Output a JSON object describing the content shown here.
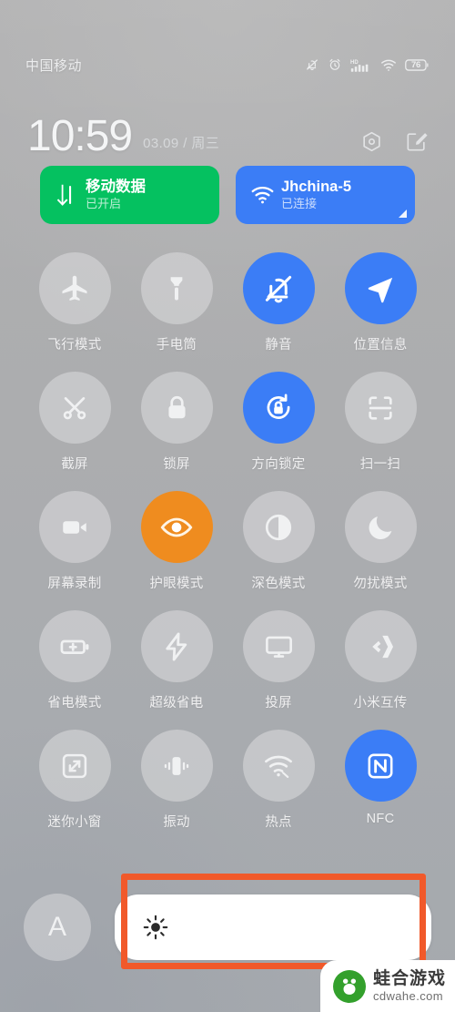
{
  "colors": {
    "accent_blue": "#3B7DF6",
    "accent_orange": "#EF8C1F",
    "accent_green": "#05C160",
    "annotation_red": "#F1592A",
    "background_gray": "#ABACAE",
    "tile_inactive": "rgba(220,221,223,.55)"
  },
  "status_bar": {
    "carrier": "中国移动",
    "battery_level": "76",
    "icons": [
      "bell-off-icon",
      "alarm-clock-icon",
      "hd-signal-icon",
      "wifi-icon",
      "battery-icon"
    ]
  },
  "header": {
    "time": "10:59",
    "date": "03.09 / 周三",
    "icons": [
      "settings-hex-icon",
      "edit-icon"
    ]
  },
  "connectivity_cards": [
    {
      "id": "mobile-data",
      "title": "移动数据",
      "subtitle": "已开启",
      "icon": "data-arrows-icon",
      "color": "#05C160",
      "has_corner_expand": false
    },
    {
      "id": "wifi",
      "title": "Jhchina-5",
      "subtitle": "已连接",
      "icon": "wifi-icon",
      "color": "#3B7DF6",
      "has_corner_expand": true
    }
  ],
  "toggles": [
    {
      "label": "飞行模式",
      "icon": "airplane-icon",
      "state": "off"
    },
    {
      "label": "手电筒",
      "icon": "flashlight-icon",
      "state": "off"
    },
    {
      "label": "静音",
      "icon": "bell-off-icon",
      "state": "on-blue"
    },
    {
      "label": "位置信息",
      "icon": "location-arrow-icon",
      "state": "on-blue"
    },
    {
      "label": "截屏",
      "icon": "screenshot-crop-icon",
      "state": "off"
    },
    {
      "label": "锁屏",
      "icon": "lock-icon",
      "state": "off"
    },
    {
      "label": "方向锁定",
      "icon": "rotation-lock-icon",
      "state": "on-blue"
    },
    {
      "label": "扫一扫",
      "icon": "scan-frame-icon",
      "state": "off"
    },
    {
      "label": "屏幕录制",
      "icon": "video-camera-icon",
      "state": "off"
    },
    {
      "label": "护眼模式",
      "icon": "eye-icon",
      "state": "on-orange"
    },
    {
      "label": "深色模式",
      "icon": "contrast-circle-icon",
      "state": "off"
    },
    {
      "label": "勿扰模式",
      "icon": "moon-icon",
      "state": "off"
    },
    {
      "label": "省电模式",
      "icon": "battery-plus-icon",
      "state": "off"
    },
    {
      "label": "超级省电",
      "icon": "lightning-bolt-icon",
      "state": "off"
    },
    {
      "label": "投屏",
      "icon": "cast-screen-icon",
      "state": "off"
    },
    {
      "label": "小米互传",
      "icon": "mi-share-icon",
      "state": "off"
    },
    {
      "label": "迷你小窗",
      "icon": "mini-window-icon",
      "state": "off"
    },
    {
      "label": "振动",
      "icon": "vibrate-icon",
      "state": "off"
    },
    {
      "label": "热点",
      "icon": "hotspot-icon",
      "state": "off"
    },
    {
      "label": "NFC",
      "icon": "nfc-icon",
      "state": "on-blue"
    }
  ],
  "brightness": {
    "auto_label": "A",
    "slider_icon": "sun-brightness-icon",
    "fill_percent": 100
  },
  "annotation": {
    "shape": "rectangle",
    "color": "#F1592A",
    "target": "brightness-slider"
  },
  "watermark": {
    "name": "蛙合游戏",
    "url": "cdwahe.com",
    "logo": "frog-hand-logo"
  }
}
